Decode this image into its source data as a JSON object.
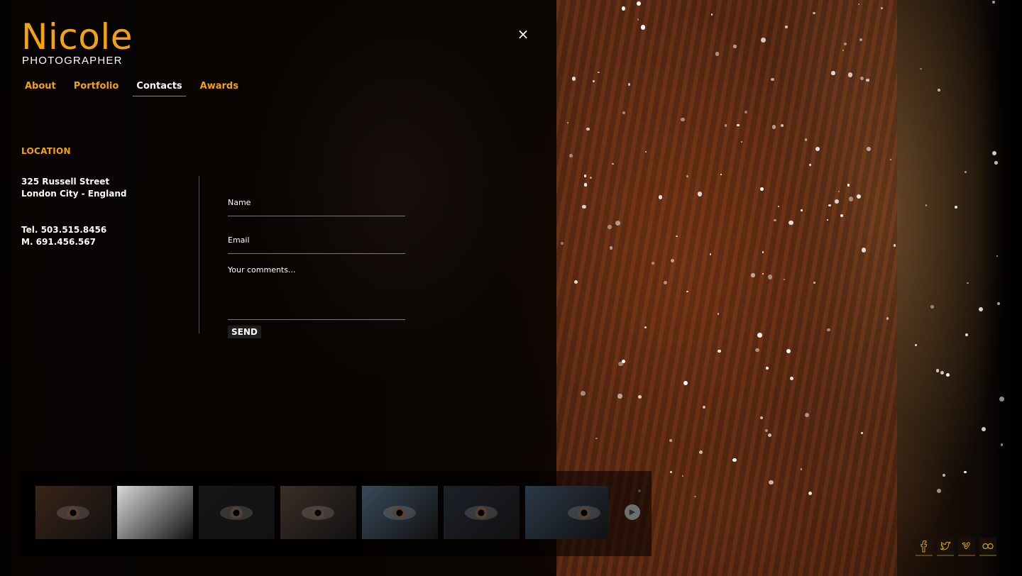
{
  "brand": {
    "name": "Nicole",
    "tagline": "PHOTOGRAPHER"
  },
  "close_label": "×",
  "nav": {
    "items": [
      {
        "label": "About",
        "active": false
      },
      {
        "label": "Portfolio",
        "active": false
      },
      {
        "label": "Contacts",
        "active": true
      },
      {
        "label": "Awards",
        "active": false
      }
    ]
  },
  "location": {
    "title": "LOCATION",
    "address_line1": "325 Russell Street",
    "address_line2": "London City - England",
    "tel": "Tel. 503.515.8456",
    "mobile": "M. 691.456.567"
  },
  "form": {
    "name_placeholder": "Name",
    "email_placeholder": "Email",
    "comments_placeholder": "Your comments...",
    "send_label": "SEND"
  },
  "thumbnails": [
    {
      "tone": "#3a2418"
    },
    {
      "tone": "#d8d8d8"
    },
    {
      "tone": "#161616"
    },
    {
      "tone": "#3a2e28"
    },
    {
      "tone": "#3a4a5a"
    },
    {
      "tone": "#1c2028"
    },
    {
      "tone": "#2a3848"
    }
  ],
  "play_icon": "play-icon",
  "social": [
    {
      "icon": "facebook-icon"
    },
    {
      "icon": "twitter-icon"
    },
    {
      "icon": "vimeo-icon"
    },
    {
      "icon": "flickr-icon"
    }
  ],
  "colors": {
    "accent": "#f5a20f",
    "text": "#ffffff",
    "panel": "rgba(0,0,0,0.78)"
  }
}
